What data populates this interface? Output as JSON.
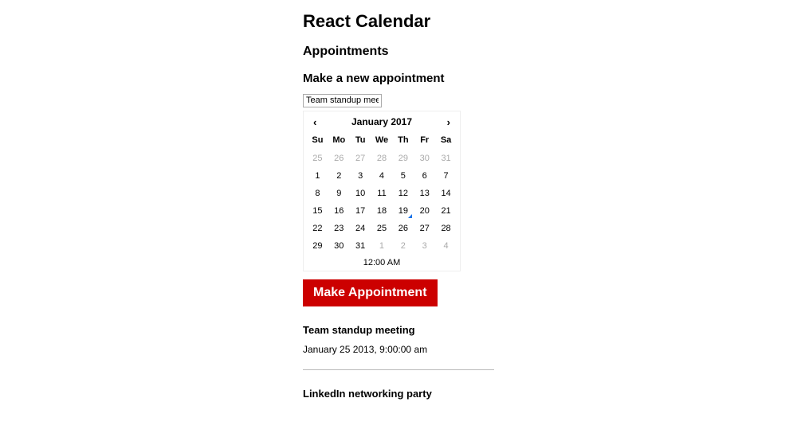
{
  "page_title": "React Calendar",
  "section_appointments": "Appointments",
  "section_new": "Make a new appointment",
  "input_value": "Team standup meetin",
  "calendar": {
    "month_label": "January 2017",
    "prev_symbol": "‹",
    "next_symbol": "›",
    "dow": [
      "Su",
      "Mo",
      "Tu",
      "We",
      "Th",
      "Fr",
      "Sa"
    ],
    "weeks": [
      [
        {
          "n": "25",
          "o": true
        },
        {
          "n": "26",
          "o": true
        },
        {
          "n": "27",
          "o": true
        },
        {
          "n": "28",
          "o": true
        },
        {
          "n": "29",
          "o": true
        },
        {
          "n": "30",
          "o": true
        },
        {
          "n": "31",
          "o": true
        }
      ],
      [
        {
          "n": "1"
        },
        {
          "n": "2"
        },
        {
          "n": "3"
        },
        {
          "n": "4"
        },
        {
          "n": "5"
        },
        {
          "n": "6"
        },
        {
          "n": "7"
        }
      ],
      [
        {
          "n": "8"
        },
        {
          "n": "9"
        },
        {
          "n": "10"
        },
        {
          "n": "11"
        },
        {
          "n": "12"
        },
        {
          "n": "13"
        },
        {
          "n": "14"
        }
      ],
      [
        {
          "n": "15"
        },
        {
          "n": "16"
        },
        {
          "n": "17"
        },
        {
          "n": "18"
        },
        {
          "n": "19",
          "today": true
        },
        {
          "n": "20"
        },
        {
          "n": "21"
        }
      ],
      [
        {
          "n": "22"
        },
        {
          "n": "23"
        },
        {
          "n": "24"
        },
        {
          "n": "25"
        },
        {
          "n": "26"
        },
        {
          "n": "27"
        },
        {
          "n": "28"
        }
      ],
      [
        {
          "n": "29"
        },
        {
          "n": "30"
        },
        {
          "n": "31"
        },
        {
          "n": "1",
          "o": true
        },
        {
          "n": "2",
          "o": true
        },
        {
          "n": "3",
          "o": true
        },
        {
          "n": "4",
          "o": true
        }
      ]
    ],
    "time_label": "12:00 AM"
  },
  "button_label": "Make Appointment",
  "appointments": [
    {
      "title": "Team standup meeting",
      "date": "January 25 2013, 9:00:00 am"
    },
    {
      "title": "LinkedIn networking party",
      "date": ""
    }
  ]
}
